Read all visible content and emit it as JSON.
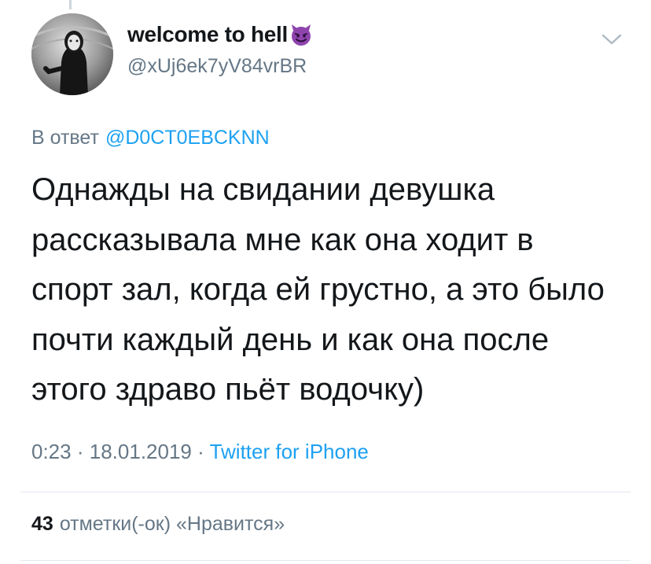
{
  "author": {
    "display_name": "welcome to hell",
    "handle": "@xUj6ek7yV84vrBR"
  },
  "reply": {
    "prefix": "В ответ",
    "mention": "@D0CT0EBCKNN"
  },
  "tweet": {
    "lines": [
      "Однажды на свидании девушка",
      "рассказывала мне как она ходит в",
      "спорт зал, когда ей грустно, а это было",
      "почти каждый день и как она после",
      "этого здраво пьёт водочку)"
    ]
  },
  "meta": {
    "time": "0:23",
    "separator": "·",
    "date": "18.01.2019",
    "source": "Twitter for iPhone"
  },
  "stats": {
    "likes_count": "43",
    "likes_label": "отметки(-ок) «Нравится»"
  },
  "icons": {
    "name_emoji": "smiling-devil-icon",
    "menu": "chevron-down-icon"
  },
  "colors": {
    "link": "#1da1f2",
    "secondary_text": "#657786",
    "primary_text": "#14171a",
    "divider": "#e1e8ed",
    "devil_purple": "#8e44ad"
  }
}
